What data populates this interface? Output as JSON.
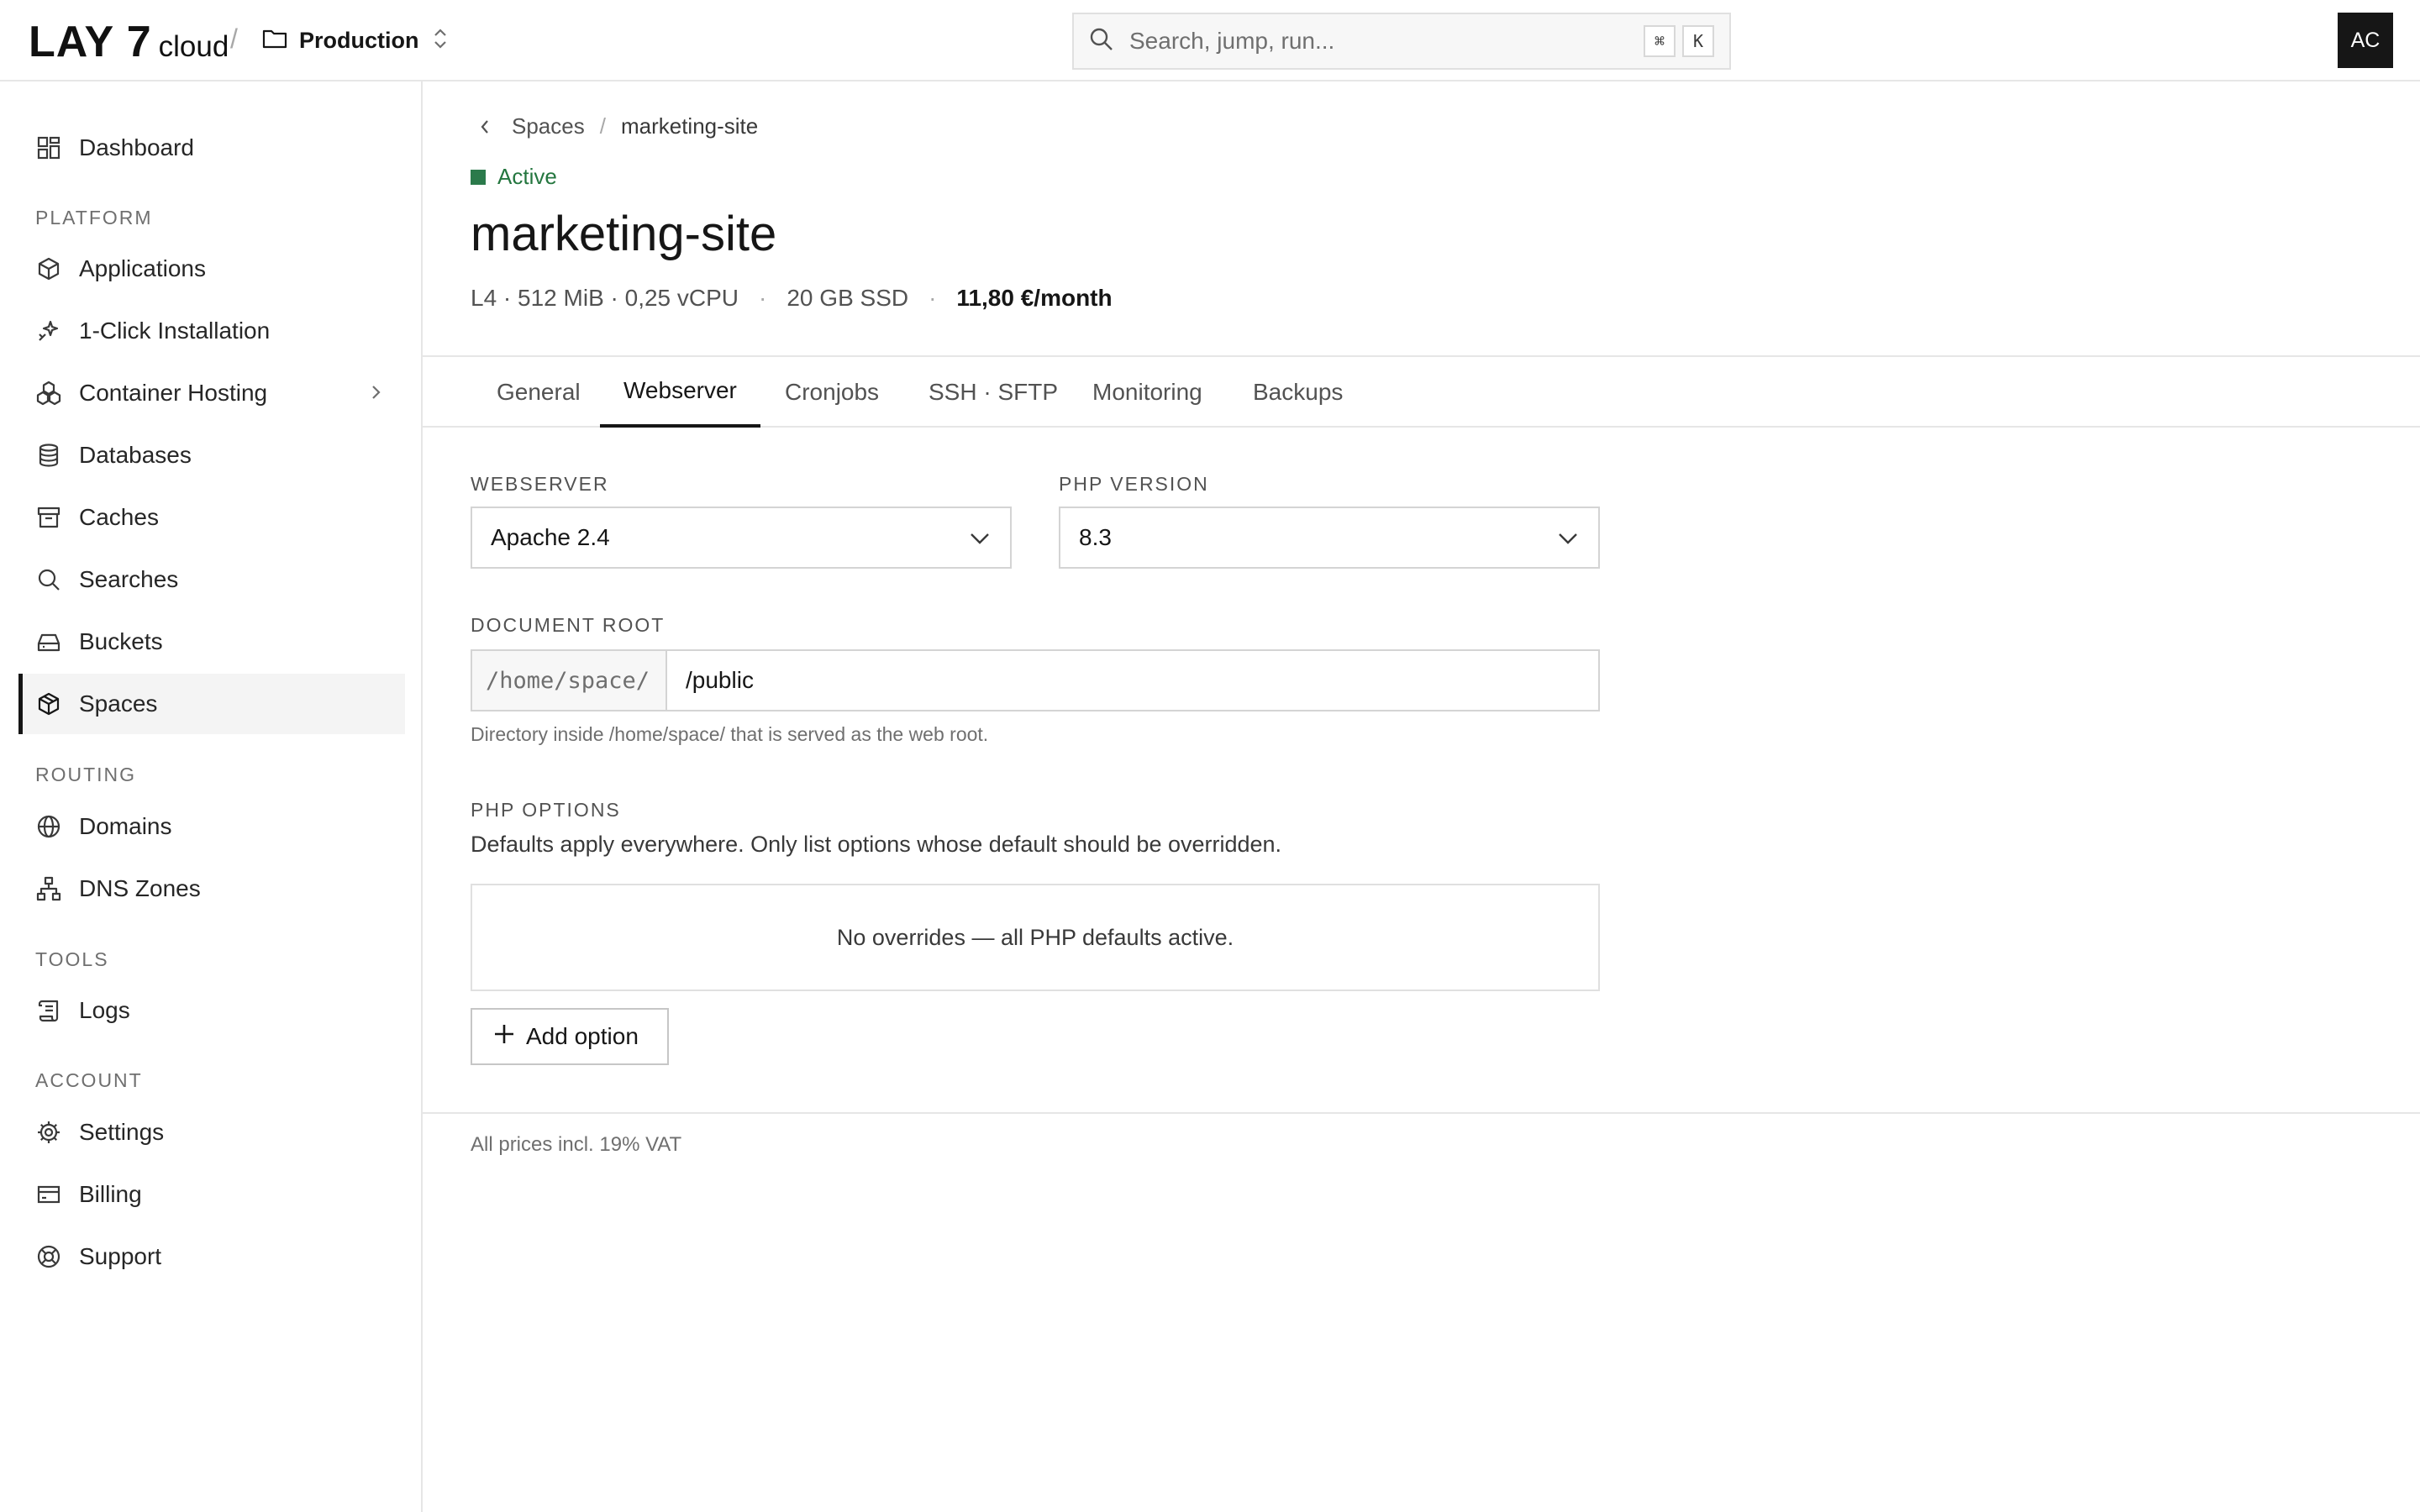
{
  "topbar": {
    "logo_main": "LAY 7",
    "logo_sub": "cloud",
    "separator": "/",
    "project": "Production",
    "search_placeholder": "Search, jump, run...",
    "shortcut_key1": "⌘",
    "shortcut_key2": "K",
    "avatar_initials": "AC"
  },
  "sidebar": {
    "dashboard": "Dashboard",
    "sections": {
      "platform": "PLATFORM",
      "routing": "ROUTING",
      "tools": "TOOLS",
      "account": "ACCOUNT"
    },
    "items": {
      "applications": "Applications",
      "one_click": "1-Click Installation",
      "container_hosting": "Container Hosting",
      "databases": "Databases",
      "caches": "Caches",
      "searches": "Searches",
      "buckets": "Buckets",
      "spaces": "Spaces",
      "domains": "Domains",
      "dns_zones": "DNS Zones",
      "logs": "Logs",
      "settings": "Settings",
      "billing": "Billing",
      "support": "Support"
    },
    "active": "Spaces"
  },
  "breadcrumb": {
    "parent": "Spaces",
    "separator": "/",
    "current": "marketing-site"
  },
  "space": {
    "status": "Active",
    "status_color": "#2b7a4b",
    "name": "marketing-site",
    "plan": "L4 · 512 MiB · 0,25 vCPU",
    "storage": "20 GB SSD",
    "price": "11,80 €/month",
    "spec_dot": "·"
  },
  "tabs": {
    "general": "General",
    "webserver": "Webserver",
    "cronjobs": "Cronjobs",
    "ssh_sftp": "SSH · SFTP",
    "monitoring": "Monitoring",
    "backups": "Backups",
    "active": "Webserver"
  },
  "form": {
    "webserver_label": "WEBSERVER",
    "webserver_value": "Apache 2.4",
    "php_label": "PHP VERSION",
    "php_value": "8.3",
    "docroot_label": "DOCUMENT ROOT",
    "docroot_prefix": "/home/space/",
    "docroot_value": "/public",
    "docroot_help": "Directory inside /home/space/ that is served as the web root.",
    "php_options_label": "PHP OPTIONS",
    "php_options_desc": "Defaults apply everywhere. Only list options whose default should be overridden.",
    "php_options_empty": "No overrides — all PHP defaults active.",
    "add_option": "Add option"
  },
  "footer": {
    "vat_note": "All prices incl. 19% VAT"
  }
}
